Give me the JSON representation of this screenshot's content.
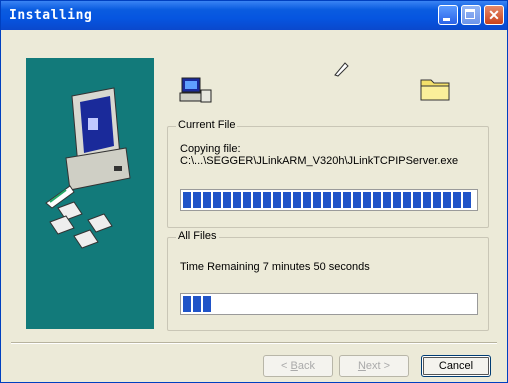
{
  "window": {
    "title": "Installing"
  },
  "icons": {
    "computer": "computer-icon",
    "folder": "folder-icon",
    "pen": "pen-icon",
    "disks": "floppy-disks-icon"
  },
  "current_file": {
    "legend": "Current File",
    "status": "Copying file:",
    "path": "C:\\...\\SEGGER\\JLinkARM_V320h\\JLinkTCPIPServer.exe",
    "progress": 1.0
  },
  "all_files": {
    "legend": "All Files",
    "status": "Time Remaining 7 minutes 50 seconds",
    "progress": 0.12
  },
  "buttons": {
    "back_pre": "< ",
    "back_u": "B",
    "back_post": "ack",
    "next_u": "N",
    "next_post": "ext >",
    "cancel": "Cancel"
  },
  "colors": {
    "title_bar": "#0a5ce0",
    "panel": "#127a7a",
    "progress_fill": "#2054c8"
  }
}
